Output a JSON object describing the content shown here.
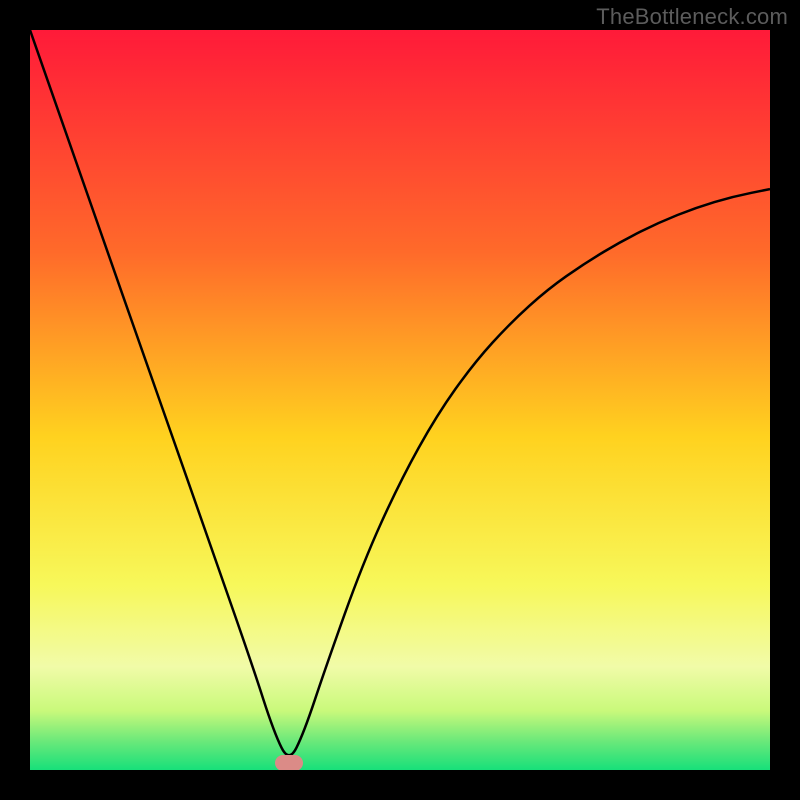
{
  "watermark": "TheBottleneck.com",
  "chart_data": {
    "type": "line",
    "title": "",
    "xlabel": "",
    "ylabel": "",
    "xlim": [
      0,
      100
    ],
    "ylim": [
      0,
      100
    ],
    "x": [
      0,
      5,
      10,
      15,
      20,
      25,
      30,
      33,
      35,
      37,
      40,
      45,
      50,
      55,
      60,
      65,
      70,
      75,
      80,
      85,
      90,
      95,
      100
    ],
    "values": [
      100,
      85.7,
      71.4,
      57.1,
      42.9,
      28.6,
      14.3,
      5.0,
      1.0,
      5.0,
      14.0,
      28.0,
      39.0,
      48.0,
      55.0,
      60.5,
      65.0,
      68.5,
      71.5,
      74.0,
      76.0,
      77.5,
      78.5
    ],
    "marker": {
      "x": 35,
      "y": 1
    },
    "gradient_stops": [
      {
        "offset": 0,
        "color": "#ff1a39"
      },
      {
        "offset": 30,
        "color": "#ff6a2a"
      },
      {
        "offset": 55,
        "color": "#ffd21f"
      },
      {
        "offset": 75,
        "color": "#f7f85a"
      },
      {
        "offset": 86,
        "color": "#f1fba8"
      },
      {
        "offset": 92,
        "color": "#c9f97b"
      },
      {
        "offset": 96,
        "color": "#6de97a"
      },
      {
        "offset": 100,
        "color": "#17e07a"
      }
    ]
  }
}
